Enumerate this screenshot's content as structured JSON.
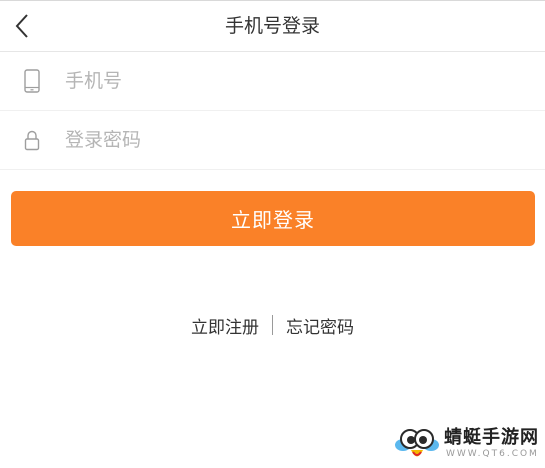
{
  "header": {
    "title": "手机号登录",
    "back_icon": "chevron-left-icon"
  },
  "form": {
    "phone": {
      "icon": "mobile-phone-icon",
      "placeholder": "手机号",
      "value": ""
    },
    "password": {
      "icon": "lock-icon",
      "placeholder": "登录密码",
      "value": ""
    },
    "login_label": "立即登录"
  },
  "links": {
    "register": "立即注册",
    "forgot": "忘记密码"
  },
  "watermark": {
    "text": "蜻蜓手游网",
    "sub": "WWW.QT6.COM"
  },
  "colors": {
    "accent": "#fa8128",
    "title_text": "#333333",
    "placeholder": "#b5b5b5",
    "background": "#ffffff"
  }
}
